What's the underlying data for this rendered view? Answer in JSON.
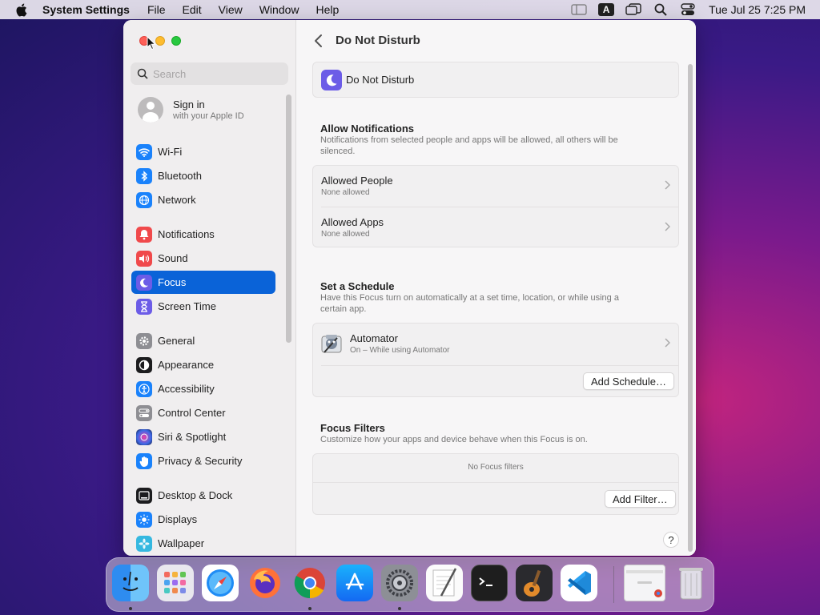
{
  "menubar": {
    "app_name": "System Settings",
    "menus": [
      "File",
      "Edit",
      "View",
      "Window",
      "Help"
    ],
    "input_source": "A",
    "clock": "Tue Jul 25  7:25 PM"
  },
  "sidebar": {
    "search_placeholder": "Search",
    "account": {
      "title": "Sign in",
      "subtitle": "with your Apple ID"
    },
    "items": [
      {
        "label": "Wi-Fi",
        "icon": "wifi-icon",
        "color": "#1a82fb"
      },
      {
        "label": "Bluetooth",
        "icon": "bluetooth-icon",
        "color": "#1a82fb"
      },
      {
        "label": "Network",
        "icon": "globe-icon",
        "color": "#1a82fb"
      },
      {
        "label": "Notifications",
        "icon": "bell-icon",
        "color": "#f0494b"
      },
      {
        "label": "Sound",
        "icon": "speaker-icon",
        "color": "#f0494b"
      },
      {
        "label": "Focus",
        "icon": "moon-icon",
        "color": "#6c5ce7"
      },
      {
        "label": "Screen Time",
        "icon": "hourglass-icon",
        "color": "#6c5ce7"
      },
      {
        "label": "General",
        "icon": "gear-icon",
        "color": "#8e8e93"
      },
      {
        "label": "Appearance",
        "icon": "appearance-icon",
        "color": "#1c1c1e"
      },
      {
        "label": "Accessibility",
        "icon": "accessibility-icon",
        "color": "#1a82fb"
      },
      {
        "label": "Control Center",
        "icon": "control-center-icon",
        "color": "#8e8e93"
      },
      {
        "label": "Siri & Spotlight",
        "icon": "siri-icon",
        "color": "#5b3bd6"
      },
      {
        "label": "Privacy & Security",
        "icon": "hand-icon",
        "color": "#1a82fb"
      },
      {
        "label": "Desktop & Dock",
        "icon": "dock-icon",
        "color": "#1c1c1e"
      },
      {
        "label": "Displays",
        "icon": "sun-icon",
        "color": "#1a82fb"
      },
      {
        "label": "Wallpaper",
        "icon": "flower-icon",
        "color": "#35b8e0"
      }
    ]
  },
  "main": {
    "title": "Do Not Disturb",
    "focus_name": "Do Not Disturb",
    "allow": {
      "title": "Allow Notifications",
      "desc": "Notifications from selected people and apps will be allowed, all others will be silenced.",
      "rows": [
        {
          "title": "Allowed People",
          "sub": "None allowed"
        },
        {
          "title": "Allowed Apps",
          "sub": "None allowed"
        }
      ]
    },
    "schedule": {
      "title": "Set a Schedule",
      "desc": "Have this Focus turn on automatically at a set time, location, or while using a certain app.",
      "item_title": "Automator",
      "item_sub": "On – While using Automator",
      "add_button": "Add Schedule…"
    },
    "filters": {
      "title": "Focus Filters",
      "desc": "Customize how your apps and device behave when this Focus is on.",
      "empty": "No Focus filters",
      "add_button": "Add Filter…"
    },
    "help": "?"
  },
  "dock": [
    "Finder",
    "Launchpad",
    "Safari",
    "Firefox",
    "Chrome",
    "App Store",
    "System Settings",
    "TextEdit",
    "Terminal",
    "GarageBand",
    "VS Code",
    "Chrome Window",
    "Trash"
  ]
}
